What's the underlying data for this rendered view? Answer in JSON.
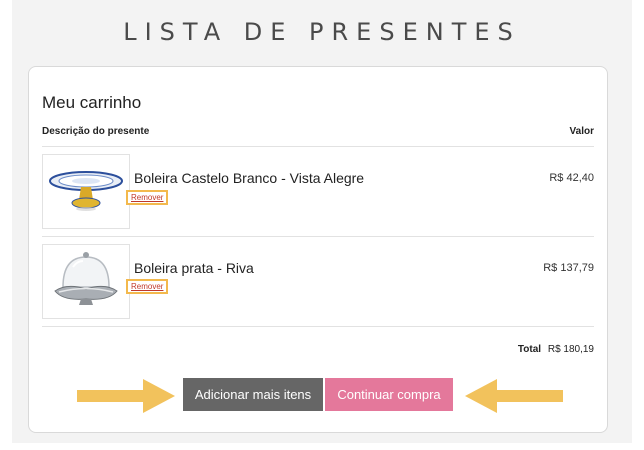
{
  "page": {
    "title": "LISTA DE PRESENTES"
  },
  "cart": {
    "heading": "Meu carrinho",
    "columns": {
      "description": "Descrição do presente",
      "value": "Valor"
    },
    "items": [
      {
        "name": "Boleira Castelo Branco - Vista Alegre",
        "remove_label": "Remover",
        "price": "R$ 42,40"
      },
      {
        "name": "Boleira prata - Riva",
        "remove_label": "Remover",
        "price": "R$ 137,79"
      }
    ],
    "total_label": "Total",
    "total_value": "R$ 180,19"
  },
  "actions": {
    "add_more_label": "Adicionar mais itens",
    "continue_label": "Continuar compra"
  },
  "colors": {
    "accent_pink": "#e4789b",
    "button_gray": "#666666",
    "highlight_orange": "#f3b94d",
    "arrow_yellow": "#f2c25c"
  },
  "icons": {
    "left_arrow": "arrow-right-icon",
    "right_arrow": "arrow-left-icon"
  }
}
